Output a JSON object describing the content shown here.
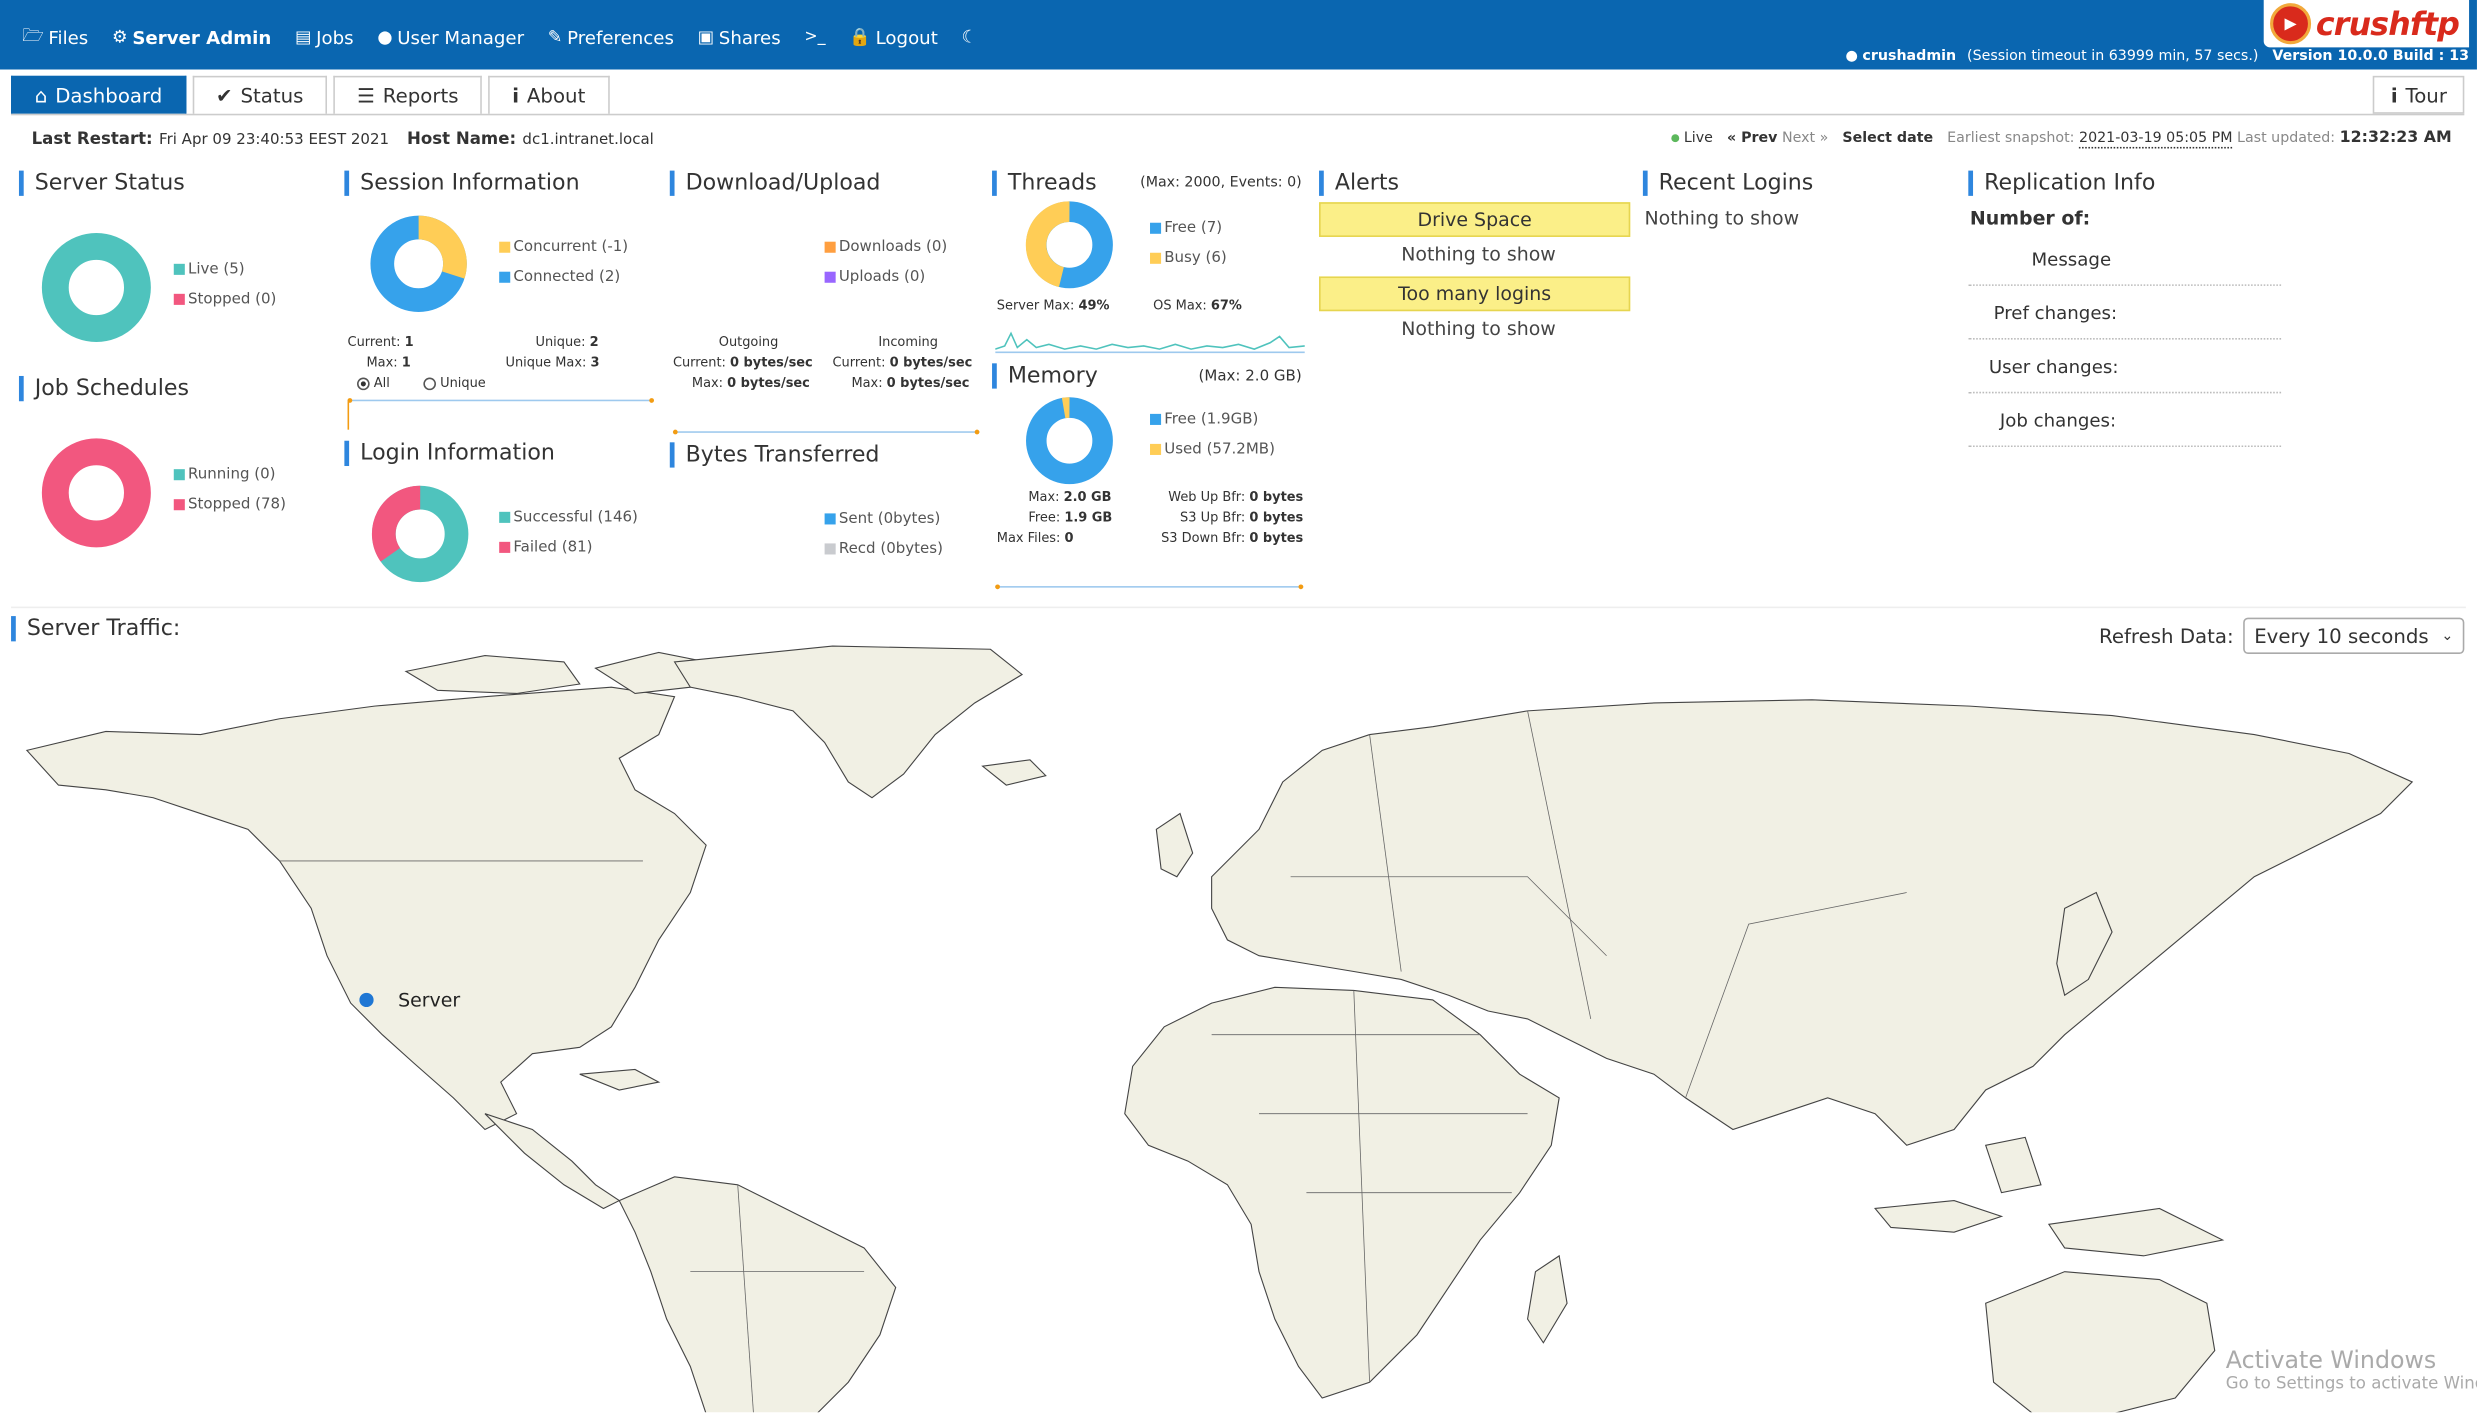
{
  "nav": {
    "items": [
      {
        "label": "Files",
        "icon": "folder-icon"
      },
      {
        "label": "Server Admin",
        "icon": "gear-icon"
      },
      {
        "label": "Jobs",
        "icon": "book-icon"
      },
      {
        "label": "User Manager",
        "icon": "user-icon"
      },
      {
        "label": "Preferences",
        "icon": "preferences-icon"
      },
      {
        "label": "Shares",
        "icon": "share-icon"
      },
      {
        "label": ">_",
        "icon": "terminal-icon"
      },
      {
        "label": "Logout",
        "icon": "lock-icon"
      }
    ],
    "brand": "crushftp",
    "user": "crushadmin",
    "session": "(Session timeout in 63999 min, 57 secs.)",
    "version": "Version 10.0.0 Build : 13"
  },
  "tabs": [
    "Dashboard",
    "Status",
    "Reports",
    "About"
  ],
  "tour": "Tour",
  "restart": {
    "label": "Last Restart:",
    "value": "Fri Apr 09 23:40:53 EEST 2021",
    "host_label": "Host Name:",
    "host": "dc1.intranet.local"
  },
  "snapshot": {
    "live": "Live",
    "prev": "« Prev",
    "next": "Next »",
    "select": "Select date",
    "earliest_label": "Earliest snapshot:",
    "earliest": "2021-03-19 05:05 PM",
    "updated_label": "Last updated:",
    "updated": "12:32:23 AM"
  },
  "server_status": {
    "title": "Server Status",
    "legend": [
      "Live (5)",
      "Stopped (0)"
    ],
    "values": [
      5,
      0
    ]
  },
  "job_schedules": {
    "title": "Job Schedules",
    "legend": [
      "Running (0)",
      "Stopped (78)"
    ],
    "values": [
      0,
      78
    ]
  },
  "session": {
    "title": "Session Information",
    "legend": [
      "Concurrent (-1)",
      "Connected (2)"
    ],
    "current_label": "Current:",
    "current": "1",
    "unique_label": "Unique:",
    "unique": "2",
    "max_label": "Max:",
    "max": "1",
    "unique_max_label": "Unique Max:",
    "unique_max": "3",
    "radio_all": "All",
    "radio_unique": "Unique"
  },
  "login": {
    "title": "Login Information",
    "legend": [
      "Successful (146)",
      "Failed (81)"
    ],
    "values": [
      146,
      81
    ]
  },
  "download": {
    "title": "Download/Upload",
    "legend": [
      "Downloads (0)",
      "Uploads (0)"
    ],
    "outgoing": "Outgoing",
    "incoming": "Incoming",
    "cur_label": "Current:",
    "cur_out": "0 bytes/sec",
    "cur_in": "0 bytes/sec",
    "max_label": "Max:",
    "max_out": "0 bytes/sec",
    "max_in": "0 bytes/sec"
  },
  "bytes": {
    "title": "Bytes Transferred",
    "legend": [
      "Sent (0bytes)",
      "Recd (0bytes)"
    ]
  },
  "threads": {
    "title": "Threads",
    "meta": "(Max: 2000, Events: 0)",
    "legend": [
      "Free (7)",
      "Busy (6)"
    ],
    "values": [
      7,
      6
    ],
    "server_max_label": "Server Max:",
    "server_max": "49%",
    "os_max_label": "OS Max:",
    "os_max": "67%"
  },
  "memory": {
    "title": "Memory",
    "meta": "(Max: 2.0 GB)",
    "legend": [
      "Free (1.9GB)",
      "Used (57.2MB)"
    ],
    "values": [
      1945,
      57.2
    ],
    "max_label": "Max:",
    "max": "2.0 GB",
    "free_label": "Free:",
    "free": "1.9 GB",
    "maxfiles_label": "Max Files:",
    "maxfiles": "0",
    "webup_label": "Web Up Bfr:",
    "webup": "0 bytes",
    "s3up_label": "S3 Up Bfr:",
    "s3up": "0 bytes",
    "s3down_label": "S3 Down Bfr:",
    "s3down": "0 bytes"
  },
  "alerts": {
    "title": "Alerts",
    "items": [
      {
        "title": "Drive Space",
        "text": "Nothing to show"
      },
      {
        "title": "Too many logins",
        "text": "Nothing to show"
      }
    ]
  },
  "recent": {
    "title": "Recent Logins",
    "text": "Nothing to show"
  },
  "replication": {
    "title": "Replication Info",
    "number_of": "Number of:",
    "rows": [
      "Message",
      "Pref changes:",
      "User changes:",
      "Job changes:"
    ]
  },
  "traffic": {
    "title": "Server Traffic:",
    "refresh_label": "Refresh Data:",
    "refresh_value": "Every 10 seconds",
    "server_label": "Server"
  },
  "watermark": {
    "line1": "Activate Windows",
    "line2": "Go to Settings to activate Windows."
  },
  "colors": {
    "teal": "#4fc3bd",
    "pink": "#f2577f",
    "yellow": "#ffcd56",
    "blue": "#36a2eb",
    "orange": "#ff9f40",
    "purple": "#9966ff",
    "gray": "#c9cbcf",
    "land": "#f1f0e4",
    "accent": "#0a66b0"
  }
}
